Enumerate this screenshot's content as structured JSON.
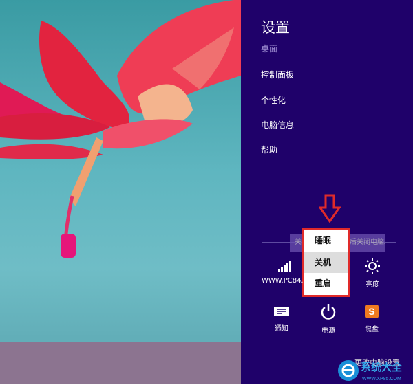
{
  "settings": {
    "title": "设置",
    "subtitle": "桌面",
    "items": [
      "控制面板",
      "个性化",
      "电脑信息",
      "帮助"
    ]
  },
  "power_tooltip": "关闭所有应用，然后关闭电脑。",
  "power_menu": {
    "items": [
      "睡眠",
      "关机",
      "重启"
    ],
    "selected": "关机"
  },
  "tiles": {
    "network": "WWW.PC84...",
    "brightness": "亮度",
    "notifications": "通知",
    "power": "电源",
    "keyboard": "键盘"
  },
  "change_settings": "更改电脑设置",
  "watermark": {
    "name": "系统大全",
    "url": "WWW.XP85.COM"
  },
  "colors": {
    "panel": "#1f016a",
    "highlight": "#e02a2a"
  }
}
